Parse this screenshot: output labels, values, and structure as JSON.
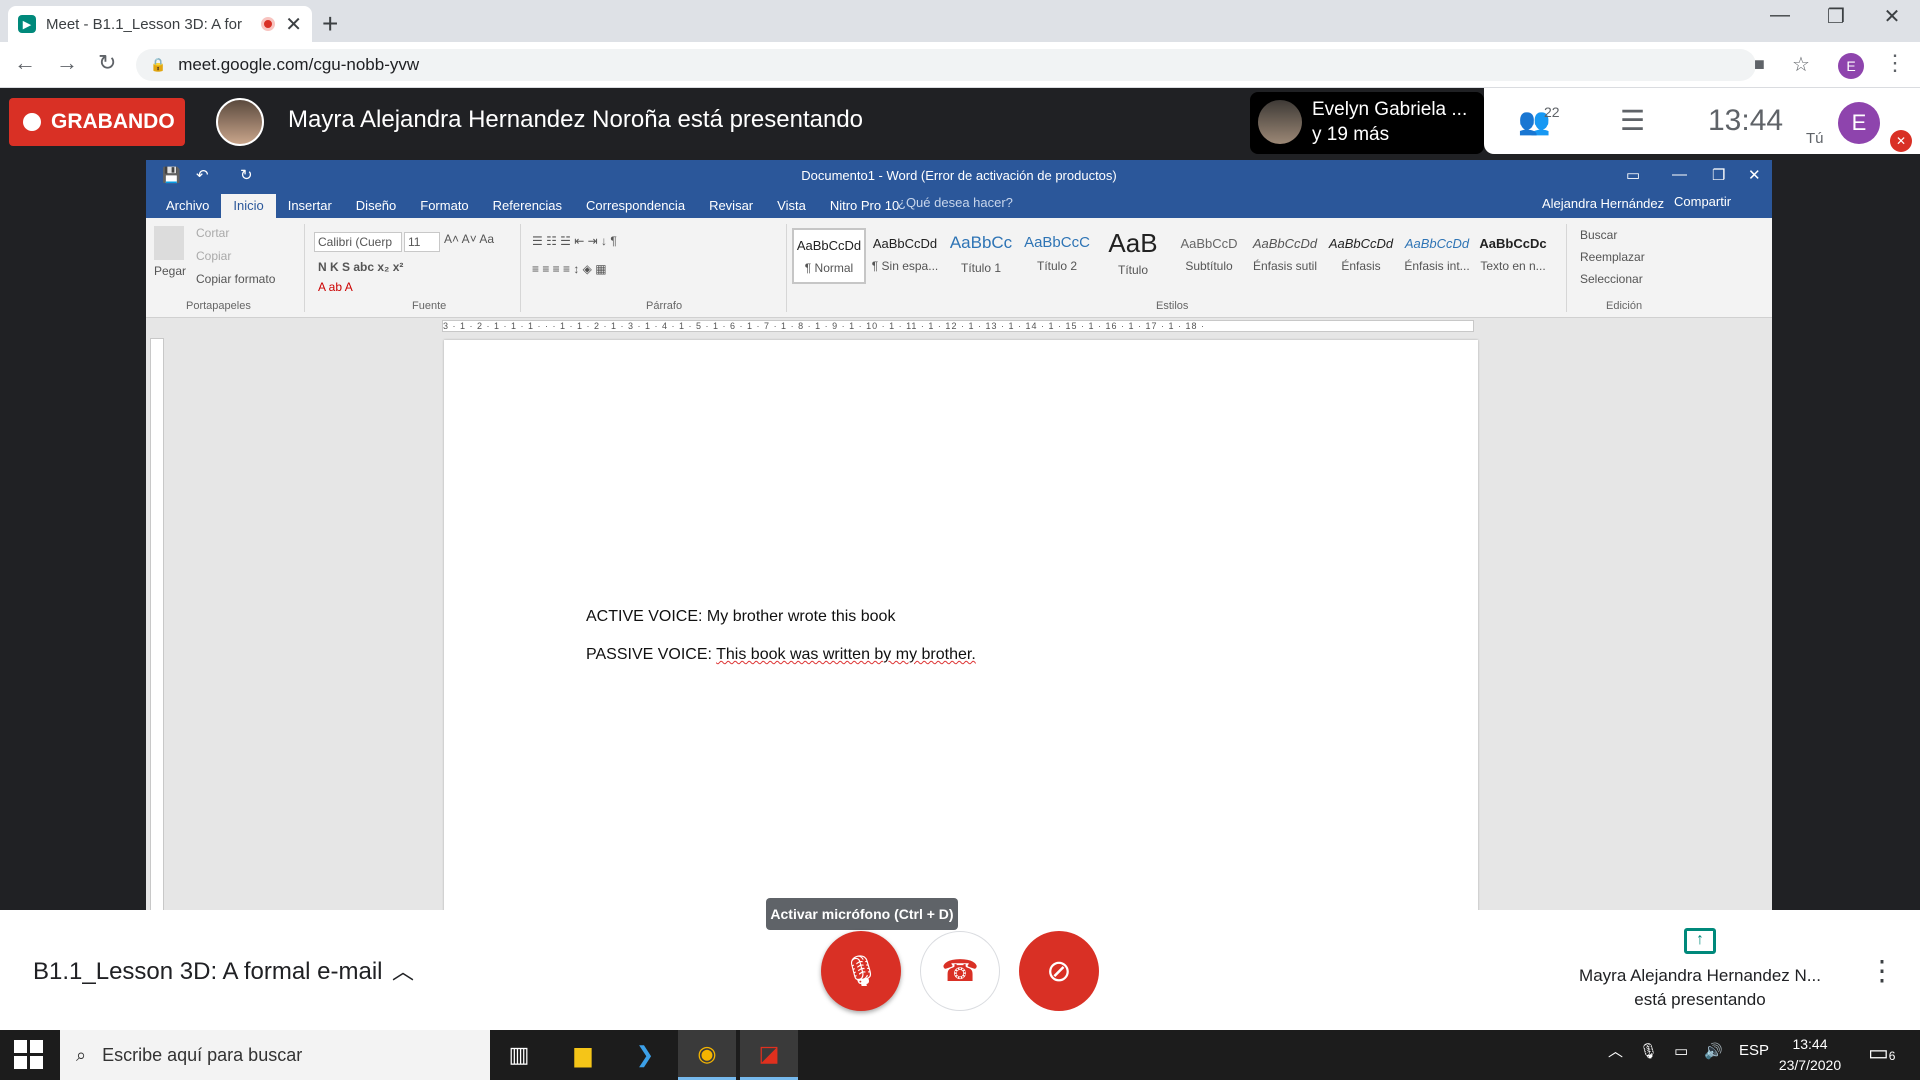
{
  "browser": {
    "tab_title": "Meet - B1.1_Lesson 3D: A for",
    "url": "meet.google.com/cgu-nobb-yvw",
    "profile_initial": "E"
  },
  "meet_top": {
    "recording_label": "GRABANDO",
    "presenting_text": "Mayra Alejandra Hernandez Noroña está presentando",
    "participant_name": "Evelyn Gabriela ...",
    "participant_more": "y 19 más",
    "people_count": "22",
    "clock": "13:44",
    "self_initial": "E",
    "self_label": "Tú"
  },
  "word": {
    "window_title": "Documento1 - Word (Error de activación de productos)",
    "tabs": [
      "Archivo",
      "Inicio",
      "Insertar",
      "Diseño",
      "Formato",
      "Referencias",
      "Correspondencia",
      "Revisar",
      "Vista",
      "Nitro Pro 10"
    ],
    "tell_me": "¿Qué desea hacer?",
    "user": "Alejandra Hernández",
    "share": "Compartir",
    "clipboard": {
      "paste": "Pegar",
      "cut": "Cortar",
      "copy": "Copiar",
      "format_painter": "Copiar formato",
      "label": "Portapapeles"
    },
    "font": {
      "name": "Calibri (Cuerp",
      "size": "11",
      "label": "Fuente"
    },
    "paragraph_label": "Párrafo",
    "styles_label": "Estilos",
    "styles": [
      {
        "sample": "AaBbCcDd",
        "name": "¶ Normal"
      },
      {
        "sample": "AaBbCcDd",
        "name": "¶ Sin espa..."
      },
      {
        "sample": "AaBbCc",
        "name": "Título 1"
      },
      {
        "sample": "AaBbCcC",
        "name": "Título 2"
      },
      {
        "sample": "AaB",
        "name": "Título"
      },
      {
        "sample": "AaBbCcD",
        "name": "Subtítulo"
      },
      {
        "sample": "AaBbCcDd",
        "name": "Énfasis sutil"
      },
      {
        "sample": "AaBbCcDd",
        "name": "Énfasis"
      },
      {
        "sample": "AaBbCcDd",
        "name": "Énfasis int..."
      },
      {
        "sample": "AaBbCcDc",
        "name": "Texto en n..."
      }
    ],
    "editing": {
      "find": "Buscar",
      "replace": "Reemplazar",
      "select": "Seleccionar",
      "label": "Edición"
    },
    "ruler_text": "3 · 1 · 2 · 1 · 1 · 1 · · · 1 · 1 · 2 · 1 · 3 · 1 · 4 · 1 · 5 · 1 · 6 · 1 · 7 · 1 · 8 · 1 · 9 · 1 · 10 · 1 · 11 · 1 · 12 · 1 · 13 · 1 · 14 · 1 · 15 · 1 · 16 · 1 · 17 · 1 · 18 ·",
    "doc": {
      "line1": "ACTIVE VOICE: My brother wrote this book",
      "line2_prefix": "PASSIVE VOICE: ",
      "line2_text": "This book was written by my brother."
    }
  },
  "meet_bottom": {
    "meeting_title": "B1.1_Lesson 3D: A formal e-mail",
    "mic_tooltip": "Activar micrófono (Ctrl + D)",
    "presenter_line1": "Mayra Alejandra Hernandez N...",
    "presenter_line2": "está presentando"
  },
  "taskbar": {
    "search_placeholder": "Escribe aquí para buscar",
    "lang": "ESP",
    "time": "13:44",
    "date": "23/7/2020",
    "notifications": "6"
  }
}
